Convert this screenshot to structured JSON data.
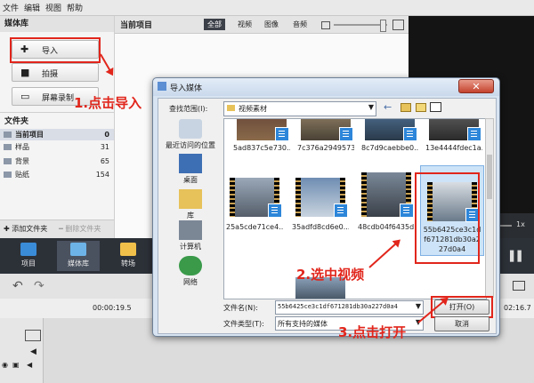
{
  "menu": [
    "文件",
    "编辑",
    "视图",
    "帮助"
  ],
  "left_panel": {
    "title": "媒体库",
    "import_label": "导入",
    "record_label": "拍摄",
    "screen_record_label": "屏幕录制",
    "folders_title": "文件夹",
    "folders": [
      {
        "name": "当前项目",
        "count": "0"
      },
      {
        "name": "样品",
        "count": "31"
      },
      {
        "name": "背景",
        "count": "65"
      },
      {
        "name": "贴纸",
        "count": "154"
      }
    ],
    "add_folder_label": "添加文件夹",
    "delete_folder_label": "删除文件夹"
  },
  "project": {
    "title": "当前项目",
    "tabs": [
      "全部",
      "视频",
      "图像",
      "音频"
    ]
  },
  "modes": [
    "项目",
    "媒体库",
    "转场"
  ],
  "timeline": {
    "time_left": "00:00:19.5",
    "time_right": "02:16.7",
    "zoom_label": "1x"
  },
  "dialog": {
    "title": "导入媒体",
    "lookin_label": "查找范围(I):",
    "lookin_value": "视频素材",
    "places": [
      "最近访问的位置",
      "桌面",
      "库",
      "计算机",
      "网络"
    ],
    "files": [
      {
        "name": "5ad837c5e730..."
      },
      {
        "name": "7c376a2949573..."
      },
      {
        "name": "8c7d9caebbe0..."
      },
      {
        "name": "13e4444fdec1a..."
      },
      {
        "name": "25a5cde71ce4..."
      },
      {
        "name": "35adfd8cd6e0..."
      },
      {
        "name": "48cdb04f6435d..."
      },
      {
        "name": "55b6425ce3c1df671281db30a227d0a4"
      }
    ],
    "filename_label": "文件名(N):",
    "filename_value": "55b6425ce3c1df671281db30a227d0a4",
    "filetype_label": "文件类型(T):",
    "filetype_value": "所有支持的媒体",
    "open_label": "打开(O)",
    "cancel_label": "取消"
  },
  "annotations": {
    "step1": "1.点击导入",
    "step2": "2.选中视频",
    "step3": "3.点击打开",
    "color": "#e1261c"
  }
}
